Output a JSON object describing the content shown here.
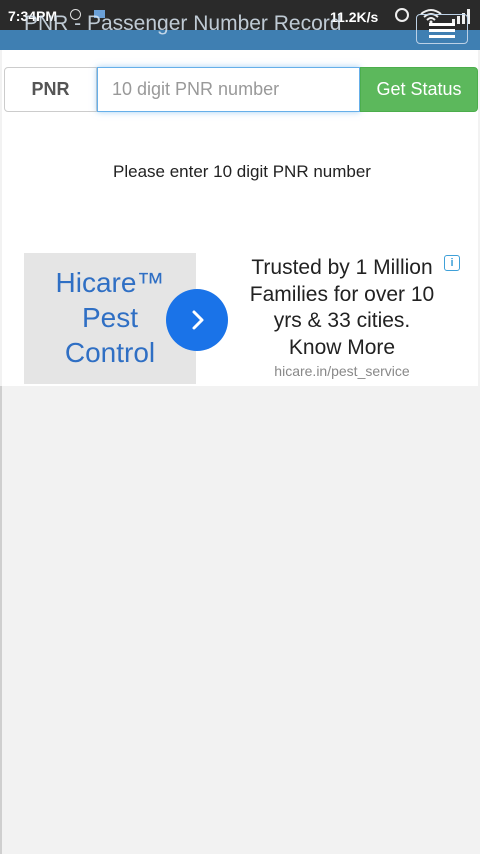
{
  "status_bar": {
    "time": "7:34PM",
    "net_speed": "11.2K/s",
    "icons": [
      "whatsapp-icon",
      "mail-icon",
      "alarm-icon",
      "wifi-icon",
      "signal-icon"
    ]
  },
  "app_bar": {
    "title": "PNR - Passenger Number Record",
    "menu_icon": "hamburger-icon",
    "color": "#3f7fb2"
  },
  "form": {
    "label": "PNR",
    "placeholder": "10 digit PNR number",
    "value": "",
    "button_label": "Get Status",
    "button_color": "#5cb85c"
  },
  "message": "Please enter 10 digit PNR number",
  "ad": {
    "brand": [
      "Hicare™",
      "Pest",
      "Control"
    ],
    "text": [
      "Trusted by 1 Million",
      "Families for over 10",
      "yrs & 33 cities.",
      "Know More"
    ],
    "url": "hicare.in/pest_service",
    "arrow_icon": "chevron-right-icon",
    "info_icon": "info-icon",
    "accent": "#1a73e8"
  }
}
